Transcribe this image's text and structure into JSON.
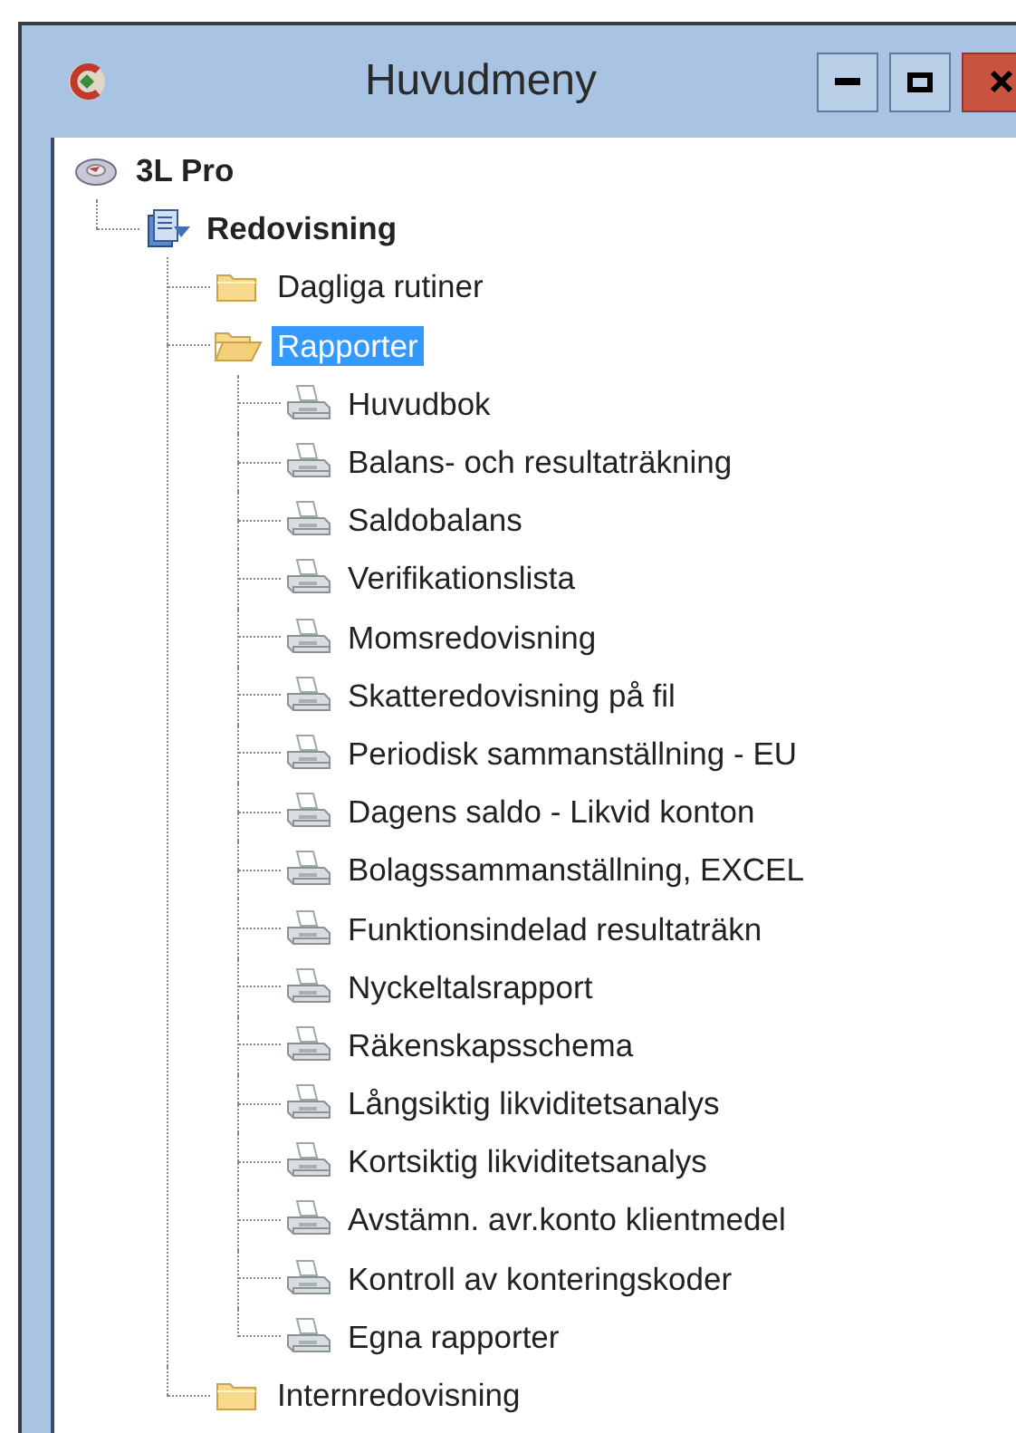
{
  "window": {
    "title": "Huvudmeny"
  },
  "tree": [
    {
      "label": "3L Pro",
      "kind": "root",
      "selected": false,
      "children": [
        {
          "label": "Redovisning",
          "kind": "module",
          "selected": false,
          "children": [
            {
              "label": "Dagliga rutiner",
              "kind": "folder",
              "selected": false,
              "expanded": false
            },
            {
              "label": "Rapporter",
              "kind": "folder",
              "selected": true,
              "expanded": true,
              "children": [
                {
                  "label": "Huvudbok",
                  "kind": "report",
                  "selected": false
                },
                {
                  "label": "Balans- och resultaträkning",
                  "kind": "report",
                  "selected": false
                },
                {
                  "label": "Saldobalans",
                  "kind": "report",
                  "selected": false
                },
                {
                  "label": "Verifikationslista",
                  "kind": "report",
                  "selected": false
                },
                {
                  "label": "Momsredovisning",
                  "kind": "report",
                  "selected": false
                },
                {
                  "label": "Skatteredovisning på fil",
                  "kind": "report",
                  "selected": false
                },
                {
                  "label": "Periodisk sammanställning - EU",
                  "kind": "report",
                  "selected": false
                },
                {
                  "label": "Dagens saldo - Likvid konton",
                  "kind": "report",
                  "selected": false
                },
                {
                  "label": "Bolagssammanställning, EXCEL",
                  "kind": "report",
                  "selected": false
                },
                {
                  "label": "Funktionsindelad resultaträkn",
                  "kind": "report",
                  "selected": false
                },
                {
                  "label": "Nyckeltalsrapport",
                  "kind": "report",
                  "selected": false
                },
                {
                  "label": "Räkenskapsschema",
                  "kind": "report",
                  "selected": false
                },
                {
                  "label": "Långsiktig likviditetsanalys",
                  "kind": "report",
                  "selected": false
                },
                {
                  "label": "Kortsiktig likviditetsanalys",
                  "kind": "report",
                  "selected": false
                },
                {
                  "label": "Avstämn. avr.konto klientmedel",
                  "kind": "report",
                  "selected": false
                },
                {
                  "label": "Kontroll av konteringskoder",
                  "kind": "report",
                  "selected": false
                },
                {
                  "label": "Egna rapporter",
                  "kind": "report",
                  "selected": false
                }
              ]
            },
            {
              "label": "Internredovisning",
              "kind": "folder",
              "selected": false,
              "expanded": false
            }
          ]
        }
      ]
    }
  ]
}
